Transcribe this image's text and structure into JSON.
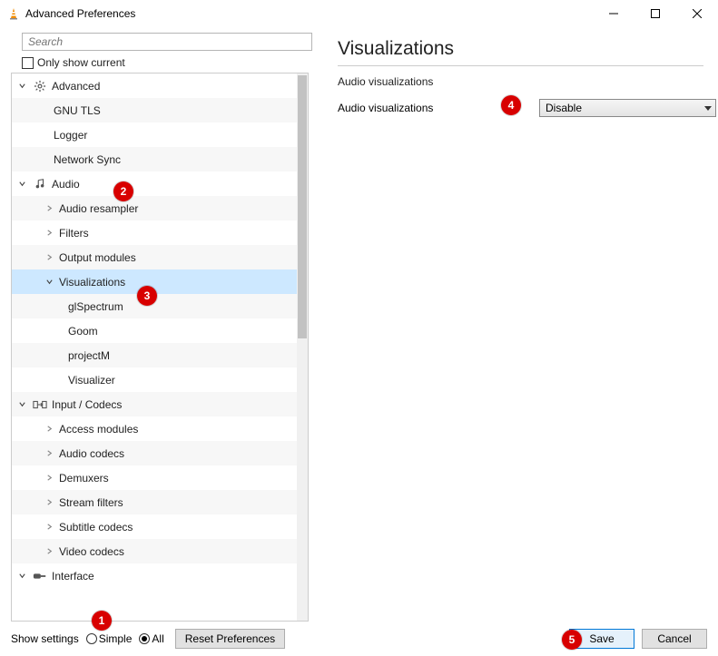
{
  "window": {
    "title": "Advanced Preferences"
  },
  "search": {
    "placeholder": "Search"
  },
  "only_current": {
    "label": "Only show current",
    "checked": false
  },
  "tree": {
    "items": [
      {
        "label": "Advanced",
        "level": 0,
        "expanded": true,
        "icon": "gear",
        "stripe": false
      },
      {
        "label": "GNU TLS",
        "level": 1,
        "expanded": null,
        "icon": null,
        "stripe": true
      },
      {
        "label": "Logger",
        "level": 1,
        "expanded": null,
        "icon": null,
        "stripe": false
      },
      {
        "label": "Network Sync",
        "level": 1,
        "expanded": null,
        "icon": null,
        "stripe": true
      },
      {
        "label": "Audio",
        "level": 0,
        "expanded": true,
        "icon": "note",
        "stripe": false
      },
      {
        "label": "Audio resampler",
        "level": 1,
        "expanded": false,
        "icon": null,
        "stripe": true
      },
      {
        "label": "Filters",
        "level": 1,
        "expanded": false,
        "icon": null,
        "stripe": false
      },
      {
        "label": "Output modules",
        "level": 1,
        "expanded": false,
        "icon": null,
        "stripe": true
      },
      {
        "label": "Visualizations",
        "level": 1,
        "expanded": true,
        "icon": null,
        "stripe": false,
        "selected": true
      },
      {
        "label": "glSpectrum",
        "level": 2,
        "expanded": null,
        "icon": null,
        "stripe": true
      },
      {
        "label": "Goom",
        "level": 2,
        "expanded": null,
        "icon": null,
        "stripe": false
      },
      {
        "label": "projectM",
        "level": 2,
        "expanded": null,
        "icon": null,
        "stripe": true
      },
      {
        "label": "Visualizer",
        "level": 2,
        "expanded": null,
        "icon": null,
        "stripe": false
      },
      {
        "label": "Input / Codecs",
        "level": 0,
        "expanded": true,
        "icon": "codec",
        "stripe": true
      },
      {
        "label": "Access modules",
        "level": 1,
        "expanded": false,
        "icon": null,
        "stripe": false
      },
      {
        "label": "Audio codecs",
        "level": 1,
        "expanded": false,
        "icon": null,
        "stripe": true
      },
      {
        "label": "Demuxers",
        "level": 1,
        "expanded": false,
        "icon": null,
        "stripe": false
      },
      {
        "label": "Stream filters",
        "level": 1,
        "expanded": false,
        "icon": null,
        "stripe": true
      },
      {
        "label": "Subtitle codecs",
        "level": 1,
        "expanded": false,
        "icon": null,
        "stripe": false
      },
      {
        "label": "Video codecs",
        "level": 1,
        "expanded": false,
        "icon": null,
        "stripe": true
      },
      {
        "label": "Interface",
        "level": 0,
        "expanded": true,
        "icon": "brush",
        "stripe": false
      }
    ]
  },
  "right": {
    "heading": "Visualizations",
    "section": "Audio visualizations",
    "opt_label": "Audio visualizations",
    "opt_value": "Disable"
  },
  "bottom": {
    "show_settings_label": "Show settings",
    "radio_simple": "Simple",
    "radio_all": "All",
    "reset": "Reset Preferences",
    "save": "Save",
    "cancel": "Cancel"
  },
  "annotations": {
    "a1": "1",
    "a2": "2",
    "a3": "3",
    "a4": "4",
    "a5": "5"
  }
}
